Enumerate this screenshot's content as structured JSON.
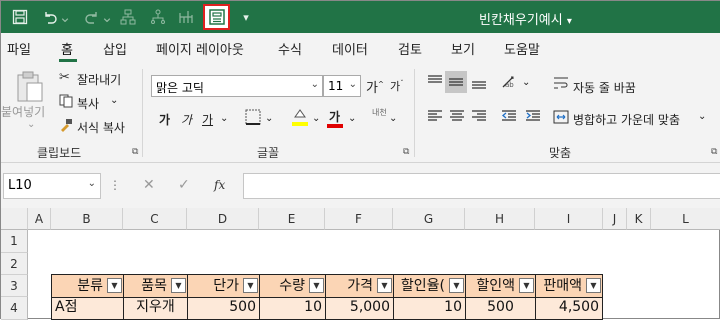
{
  "title_bar": {
    "document_title": "빈칸채우기예시",
    "title_dropdown": "▾"
  },
  "quick_access": {
    "icons": [
      "save-icon",
      "undo-icon",
      "redo-icon",
      "org-chart-icon",
      "tree-icon",
      "hierarchy-icon",
      "form-icon",
      "customize-icon"
    ]
  },
  "tabs": [
    "파일",
    "홈",
    "삽입",
    "페이지 레이아웃",
    "수식",
    "데이터",
    "검토",
    "보기",
    "도움말"
  ],
  "active_tab": "홈",
  "clipboard": {
    "paste_label": "붙여넣기",
    "cut_label": "잘라내기",
    "copy_label": "복사",
    "format_painter_label": "서식 복사",
    "group_label": "클립보드"
  },
  "font": {
    "font_name": "맑은 고딕",
    "font_size": "11",
    "grow_label": "가",
    "shrink_label": "가",
    "bold": "가",
    "italic": "가",
    "underline": "가",
    "phonetic": "내천",
    "fill_color_hex": "#ffff00",
    "font_color_hex": "#e00000",
    "font_color_label": "가",
    "group_label": "글꼴"
  },
  "alignment": {
    "wrap_text_label": "자동 줄 바꿈",
    "merge_center_label": "병합하고 가운데 맞춤",
    "group_label": "맞춤"
  },
  "formula_bar": {
    "name_box": "L10",
    "cancel_symbol": "✕",
    "enter_symbol": "✓",
    "fx_symbol": "fx",
    "formula_value": ""
  },
  "grid": {
    "columns": [
      "A",
      "B",
      "C",
      "D",
      "E",
      "F",
      "G",
      "H",
      "I",
      "J",
      "K",
      "L"
    ],
    "rows": [
      "1",
      "2",
      "3",
      "4"
    ],
    "table_headers": [
      "분류",
      "품목",
      "단가",
      "수량",
      "가격",
      "할인율(",
      "할인액",
      "판매액"
    ],
    "row4": [
      "A점",
      "지우개",
      "500",
      "10",
      "5,000",
      "10",
      "500",
      "4,500"
    ]
  },
  "colors": {
    "excel_green": "#217346",
    "header_fill": "#fbd5b5",
    "data_fill": "#fde9d9",
    "highlight_box": "#e02020"
  }
}
